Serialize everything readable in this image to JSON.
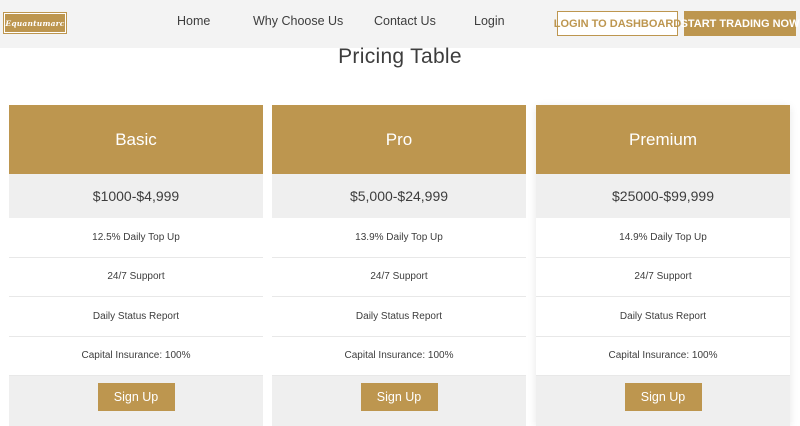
{
  "header": {
    "logo_text": "Equantumarc",
    "nav": [
      {
        "label": "Home"
      },
      {
        "label": "Why Choose Us"
      },
      {
        "label": "Contact Us"
      },
      {
        "label": "Login"
      }
    ],
    "login_dashboard_label": "LOGIN TO DASHBOARD",
    "start_trading_label": "START TRADING NOW"
  },
  "main": {
    "title": "Pricing Table",
    "plans": [
      {
        "name": "Basic",
        "price": "$1000-$4,999",
        "features": [
          "12.5% Daily Top Up",
          "24/7 Support",
          "Daily Status Report",
          "Capital Insurance: 100%"
        ],
        "cta": "Sign Up"
      },
      {
        "name": "Pro",
        "price": "$5,000-$24,999",
        "features": [
          "13.9% Daily Top Up",
          "24/7 Support",
          "Daily Status Report",
          "Capital Insurance: 100%"
        ],
        "cta": "Sign Up"
      },
      {
        "name": "Premium",
        "price": "$25000-$99,999",
        "features": [
          "14.9% Daily Top Up",
          "24/7 Support",
          "Daily Status Report",
          "Capital Insurance: 100%"
        ],
        "cta": "Sign Up"
      }
    ]
  },
  "colors": {
    "accent": "#bd964f",
    "header_bg": "#f3f3f3",
    "price_bg": "#efefef",
    "text": "#3d3d3d"
  }
}
